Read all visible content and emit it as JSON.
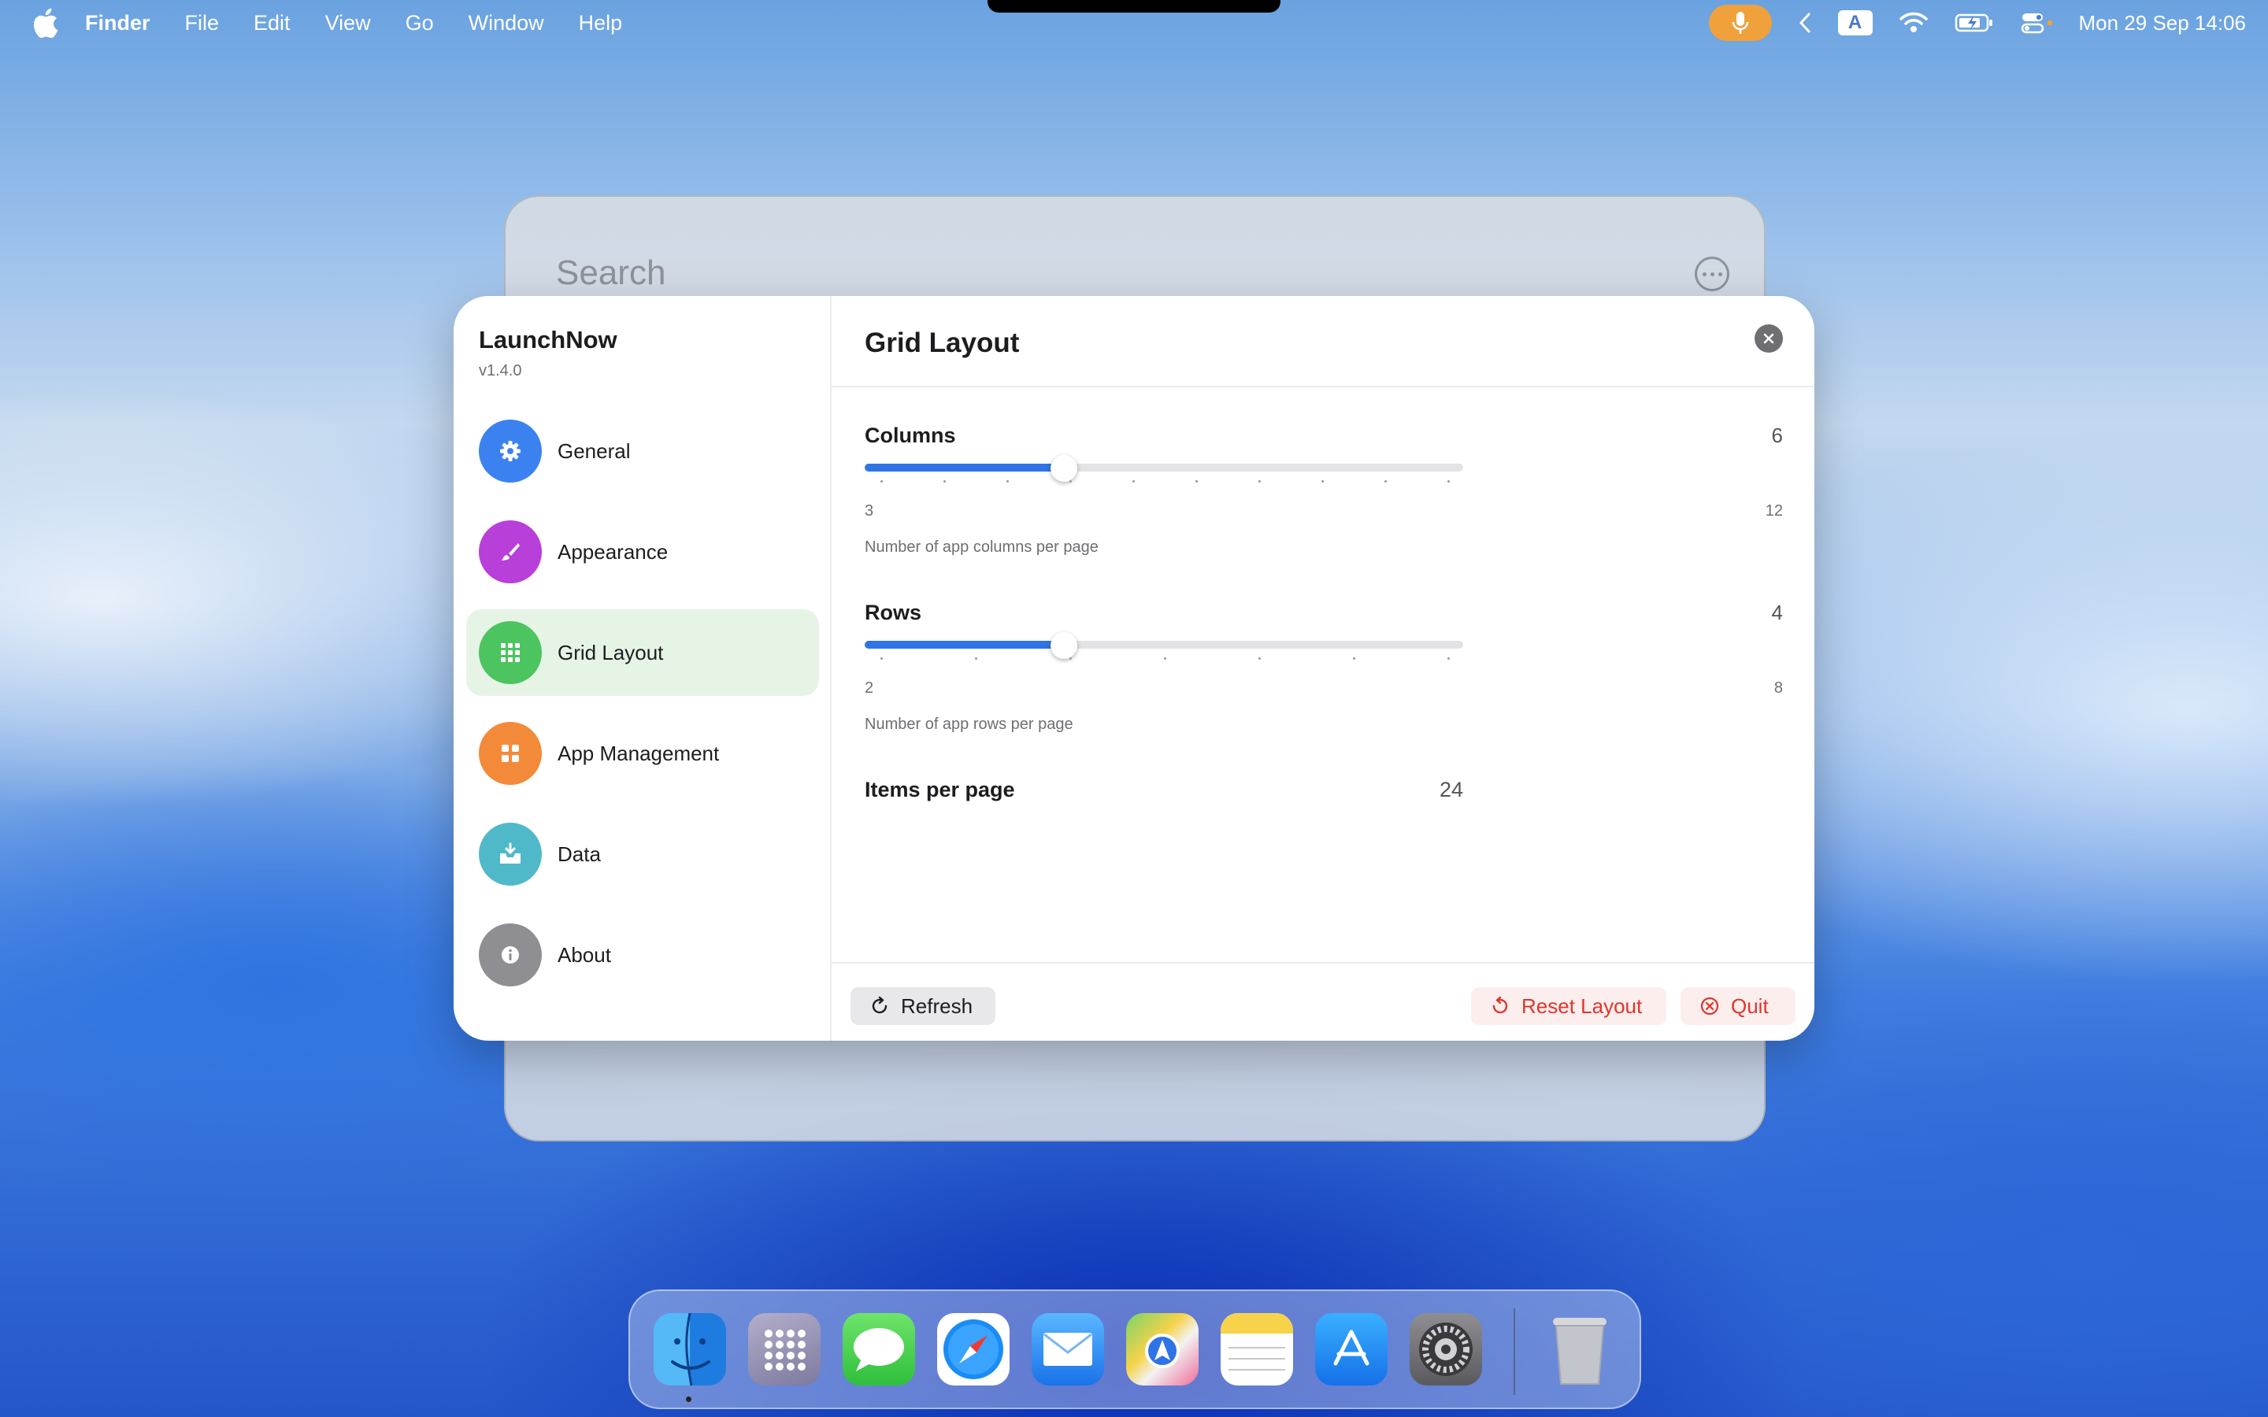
{
  "menubar": {
    "app_name": "Finder",
    "menus": [
      "File",
      "Edit",
      "View",
      "Go",
      "Window",
      "Help"
    ],
    "status_icons": [
      "microphone-icon",
      "chevron-left-icon",
      "keyboard-input-icon",
      "wifi-icon",
      "battery-icon",
      "control-center-icon"
    ],
    "input_source": "A",
    "clock": "Mon 29 Sep  14:06"
  },
  "launcher": {
    "search_placeholder": "Search"
  },
  "settings": {
    "app_title": "LaunchNow",
    "version": "v1.4.0",
    "nav": [
      {
        "label": "General",
        "icon": "gear-icon",
        "color": "#3b82f0"
      },
      {
        "label": "Appearance",
        "icon": "paintbrush-icon",
        "color": "#b83fd9"
      },
      {
        "label": "Grid Layout",
        "icon": "grid-icon",
        "color": "#4cc460",
        "active": true
      },
      {
        "label": "App Management",
        "icon": "apps-icon",
        "color": "#f28a3a"
      },
      {
        "label": "Data",
        "icon": "tray-download-icon",
        "color": "#4fb9c9"
      },
      {
        "label": "About",
        "icon": "info-icon",
        "color": "#8e8e93"
      }
    ],
    "panel_title": "Grid Layout",
    "columns": {
      "label": "Columns",
      "value": "6",
      "min": "3",
      "max": "12",
      "fraction": 0.333,
      "description": "Number of app columns per page"
    },
    "rows": {
      "label": "Rows",
      "value": "4",
      "min": "2",
      "max": "8",
      "fraction": 0.333,
      "description": "Number of app rows per page"
    },
    "items_per_page": {
      "label": "Items per page",
      "value": "24"
    },
    "footer": {
      "refresh": "Refresh",
      "reset": "Reset Layout",
      "quit": "Quit"
    }
  },
  "dock": {
    "apps": [
      "Finder",
      "Launchpad",
      "Messages",
      "Safari",
      "Mail",
      "Maps",
      "Notes",
      "App Store",
      "System Settings"
    ],
    "trash": "Trash"
  }
}
